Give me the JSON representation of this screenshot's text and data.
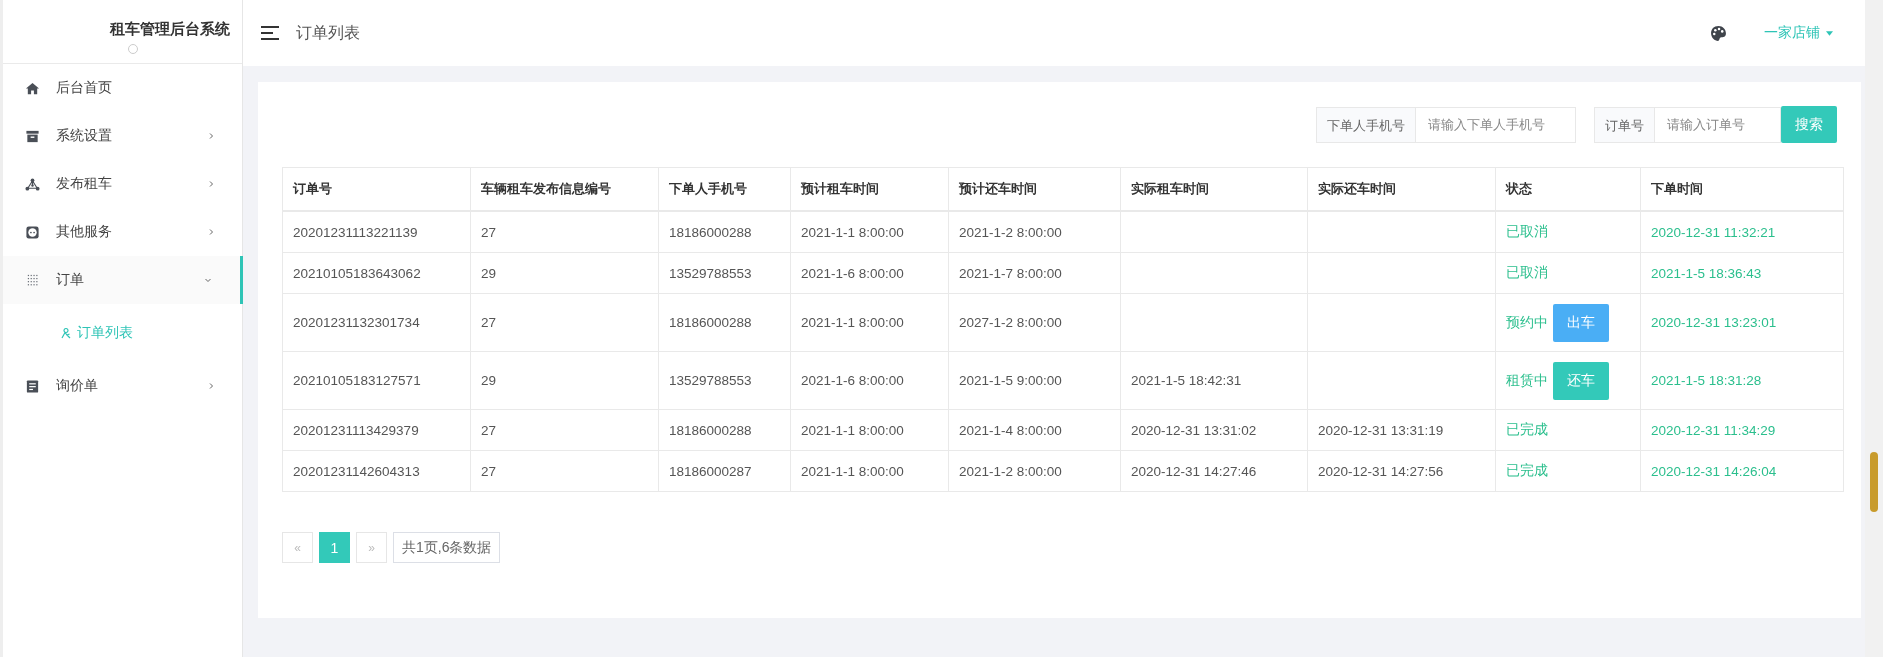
{
  "sidebar": {
    "title": "租车管理后台系统",
    "items": [
      {
        "label": "后台首页"
      },
      {
        "label": "系统设置",
        "expanded": false
      },
      {
        "label": "发布租车",
        "expanded": false
      },
      {
        "label": "其他服务",
        "expanded": false
      },
      {
        "label": "订单",
        "expanded": true,
        "children": [
          {
            "label": "订单列表",
            "selected": true
          }
        ]
      },
      {
        "label": "询价单",
        "expanded": false
      }
    ]
  },
  "header": {
    "breadcrumb": "订单列表",
    "store": "一家店铺"
  },
  "search": {
    "fields": [
      {
        "label": "下单人手机号",
        "placeholder": "请输入下单人手机号"
      },
      {
        "label": "订单号",
        "placeholder": "请输入订单号"
      }
    ],
    "button": "搜索"
  },
  "table": {
    "columns": [
      "订单号",
      "车辆租车发布信息编号",
      "下单人手机号",
      "预计租车时间",
      "预计还车时间",
      "实际租车时间",
      "实际还车时间",
      "状态",
      "下单时间"
    ],
    "rows": [
      {
        "cells": [
          "20201231113221139",
          "27",
          "18186000288",
          "2021-1-1 8:00:00",
          "2021-1-2 8:00:00",
          "",
          ""
        ],
        "status": "已取消",
        "order_time": "2020-12-31 11:32:21"
      },
      {
        "cells": [
          "20210105183643062",
          "29",
          "13529788553",
          "2021-1-6 8:00:00",
          "2021-1-7 8:00:00",
          "",
          ""
        ],
        "status": "已取消",
        "order_time": "2021-1-5 18:36:43"
      },
      {
        "cells": [
          "20201231132301734",
          "27",
          "18186000288",
          "2021-1-1 8:00:00",
          "2027-1-2 8:00:00",
          "",
          ""
        ],
        "status": "预约中",
        "action": {
          "label": "出车",
          "color": "#4aaef5"
        },
        "order_time": "2020-12-31 13:23:01"
      },
      {
        "cells": [
          "20210105183127571",
          "29",
          "13529788553",
          "2021-1-6 8:00:00",
          "2021-1-5 9:00:00",
          "2021-1-5 18:42:31",
          ""
        ],
        "status": "租赁中",
        "action": {
          "label": "还车",
          "color": "#33c9b9"
        },
        "order_time": "2021-1-5 18:31:28"
      },
      {
        "cells": [
          "20201231113429379",
          "27",
          "18186000288",
          "2021-1-1 8:00:00",
          "2021-1-4 8:00:00",
          "2020-12-31 13:31:02",
          "2020-12-31 13:31:19"
        ],
        "status": "已完成",
        "order_time": "2020-12-31 11:34:29"
      },
      {
        "cells": [
          "20201231142604313",
          "27",
          "18186000287",
          "2021-1-1 8:00:00",
          "2021-1-2 8:00:00",
          "2020-12-31 14:27:46",
          "2020-12-31 14:27:56"
        ],
        "status": "已完成",
        "order_time": "2020-12-31 14:26:04"
      }
    ]
  },
  "pagination": {
    "prev": "«",
    "pages": [
      {
        "label": "1",
        "selected": true
      }
    ],
    "next": "»",
    "summary": "共1页,6条数据"
  }
}
